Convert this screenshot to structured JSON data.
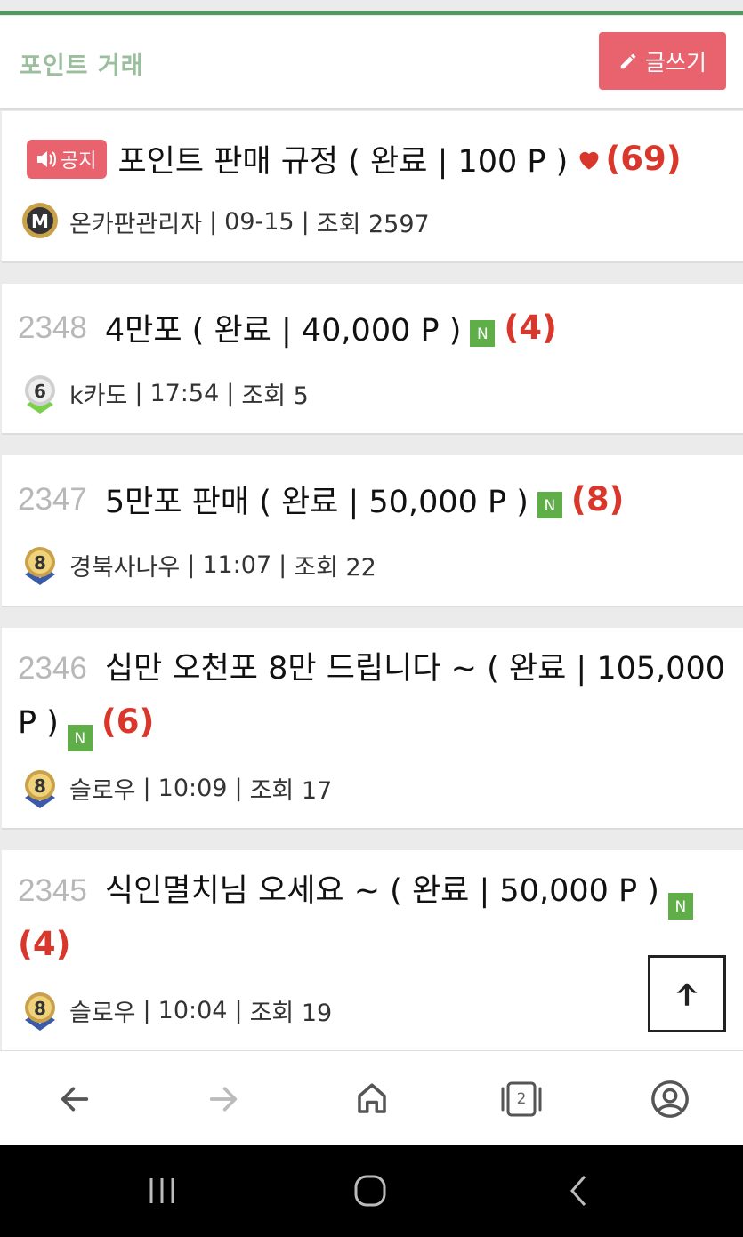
{
  "header": {
    "board_title": "포인트 거래",
    "write_label": "글쓰기"
  },
  "posts": [
    {
      "notice_label": "공지",
      "title": "포인트 판매 규정 ( 완료 | 100 P )",
      "comments": "(69)",
      "author": "온카판관리자",
      "date": "09-15",
      "views": "조회 2597",
      "level": "M"
    },
    {
      "number": "2348",
      "title": "4만포 ( 완료 | 40,000 P )",
      "new_label": "N",
      "comments": "(4)",
      "author": "k카도",
      "date": "17:54",
      "views": "조회 5",
      "level": "6"
    },
    {
      "number": "2347",
      "title": "5만포 판매 ( 완료 | 50,000 P )",
      "new_label": "N",
      "comments": "(8)",
      "author": "경북사나우",
      "date": "11:07",
      "views": "조회 22",
      "level": "8"
    },
    {
      "number": "2346",
      "title": "십만 오천포 8만 드립니다 ~ ( 완료 | 105,000 P )",
      "new_label": "N",
      "comments": "(6)",
      "author": "슬로우",
      "date": "10:09",
      "views": "조회 17",
      "level": "8"
    },
    {
      "number": "2345",
      "title": "식인멸치님 오세요 ~ ( 완료 | 50,000 P )",
      "new_label": "N",
      "comments": "(4)",
      "author": "슬로우",
      "date": "10:04",
      "views": "조회 19",
      "level": "8"
    }
  ],
  "browser_nav": {
    "tabs_count": "2",
    "icons": [
      "back-arrow-icon",
      "forward-arrow-icon",
      "home-icon",
      "tabs-icon",
      "account-icon"
    ]
  },
  "colors": {
    "accent_green": "#4f9a60",
    "write_button": "#e9636f",
    "new_badge": "#5fae48",
    "comment_count": "#d9372b"
  }
}
